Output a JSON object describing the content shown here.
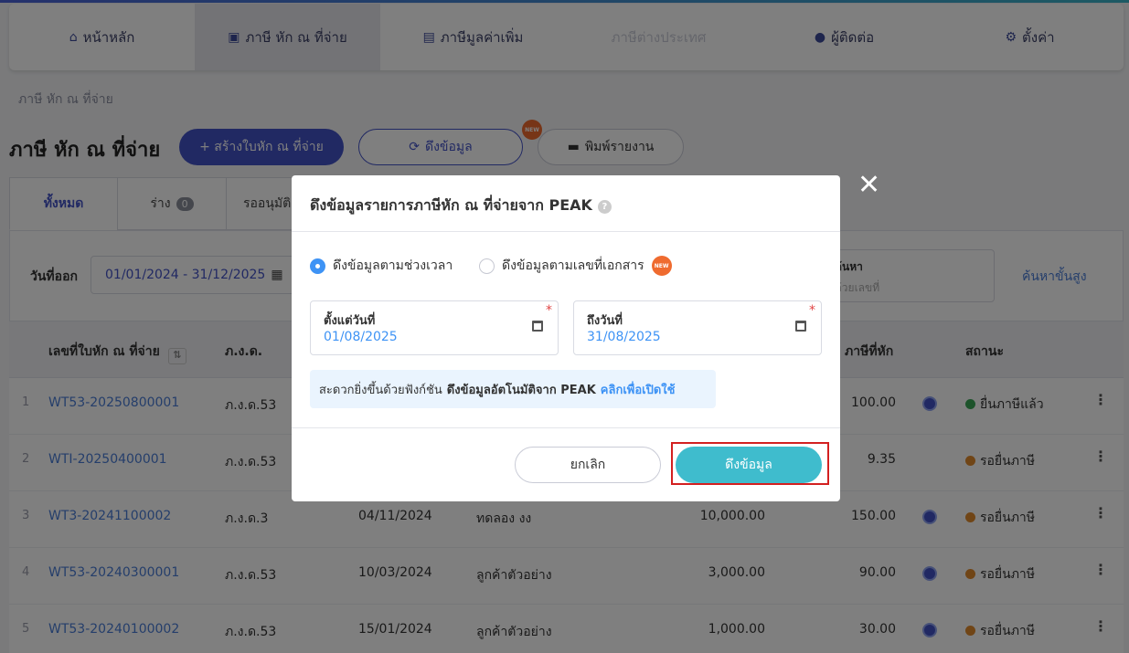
{
  "nav": {
    "items": [
      {
        "label": "หน้าหลัก",
        "icon": "home-icon",
        "glyph": "⌂"
      },
      {
        "label": "ภาษี หัก ณ ที่จ่าย",
        "icon": "wallet-icon",
        "glyph": "▣"
      },
      {
        "label": "ภาษีมูลค่าเพิ่ม",
        "icon": "receipt-icon",
        "glyph": "▤"
      },
      {
        "label": "ภาษีต่างประเทศ",
        "icon": "",
        "glyph": ""
      },
      {
        "label": "ผู้ติดต่อ",
        "icon": "user-icon",
        "glyph": "●"
      },
      {
        "label": "ตั้งค่า",
        "icon": "gear-icon",
        "glyph": "⚙"
      }
    ]
  },
  "breadcrumb": "ภาษี หัก ณ ที่จ่าย",
  "page_title": "ภาษี หัก ณ ที่จ่าย",
  "toolbar": {
    "create_label": "+ สร้างใบหัก ณ ที่จ่าย",
    "fetch_label": "ดึงข้อมูล",
    "print_label": "พิมพ์รายงาน",
    "new_badge": "NEW"
  },
  "tabs": [
    {
      "label": "ทั้งหมด"
    },
    {
      "label": "ร่าง",
      "count": "0"
    },
    {
      "label": "รออนุมัติ"
    }
  ],
  "filter": {
    "date_label": "วันที่ออก",
    "date_range": "01/01/2024 - 31/12/2025",
    "search_label": "ค้นหา",
    "search_placeholder": "ด้วยเลขที่",
    "advanced_label": "ค้นหาขั้นสูง"
  },
  "table": {
    "headers": {
      "doc_no": "เลขที่ใบหัก ณ ที่จ่าย",
      "form": "ภ.ง.ด.",
      "tax": "ภาษีที่หัก",
      "status": "สถานะ"
    },
    "rows": [
      {
        "no": "1",
        "doc": "WT53-20250800001",
        "form": "ภ.ง.ด.53",
        "date": "",
        "name": "",
        "amount": "",
        "tax": "100.00",
        "status": "ยื่นภาษีแล้ว",
        "status_color": "#3aa757",
        "has_icon": true
      },
      {
        "no": "2",
        "doc": "WTI-20250400001",
        "form": "ภ.ง.ด.53",
        "date": "",
        "name": "",
        "amount": "",
        "tax": "9.35",
        "status": "รอยื่นภาษี",
        "status_color": "#e08a2c",
        "has_icon": false
      },
      {
        "no": "3",
        "doc": "WT3-20241100002",
        "form": "ภ.ง.ด.3",
        "date": "04/11/2024",
        "name": "ทดลอง งง",
        "amount": "10,000.00",
        "tax": "150.00",
        "status": "รอยื่นภาษี",
        "status_color": "#e08a2c",
        "has_icon": true
      },
      {
        "no": "4",
        "doc": "WT53-20240300001",
        "form": "ภ.ง.ด.53",
        "date": "10/03/2024",
        "name": "ลูกค้าตัวอย่าง",
        "amount": "3,000.00",
        "tax": "90.00",
        "status": "รอยื่นภาษี",
        "status_color": "#e08a2c",
        "has_icon": true
      },
      {
        "no": "5",
        "doc": "WT53-20240100002",
        "form": "ภ.ง.ด.53",
        "date": "15/01/2024",
        "name": "ลูกค้าตัวอย่าง",
        "amount": "1,000.00",
        "tax": "30.00",
        "status": "รอยื่นภาษี",
        "status_color": "#e08a2c",
        "has_icon": true
      }
    ]
  },
  "modal": {
    "title": "ดึงข้อมูลรายการภาษีหัก ณ ที่จ่ายจาก PEAK",
    "radio_period": "ดึงข้อมูลตามช่วงเวลา",
    "radio_docno": "ดึงข้อมูลตามเลขที่เอกสาร",
    "new_badge": "NEW",
    "from_label": "ตั้งแต่วันที่",
    "from_value": "01/08/2025",
    "to_label": "ถึงวันที่",
    "to_value": "31/08/2025",
    "info_text": "สะดวกยิ่งขึ้นด้วยฟังก์ชัน",
    "info_strong": "ดึงข้อมูลอัตโนมัติจาก PEAK",
    "info_link": "คลิกเพื่อเปิดใช้",
    "cancel_label": "ยกเลิก",
    "submit_label": "ดึงข้อมูล"
  }
}
